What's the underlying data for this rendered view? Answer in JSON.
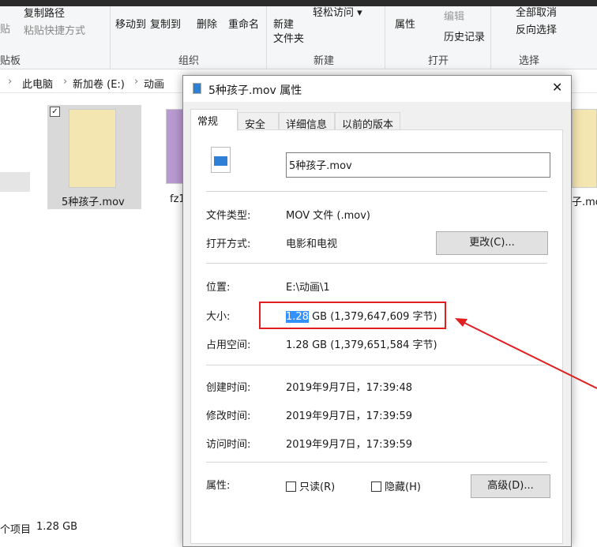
{
  "ribbon": {
    "copy_path": "复制路径",
    "paste_shortcut": "粘贴快捷方式",
    "paste_partial": "贴",
    "move_to": "移动到",
    "copy_to": "复制到",
    "delete": "删除",
    "rename": "重命名",
    "new_folder_1": "新建",
    "new_folder_2": "文件夹",
    "easy_access": "轻松访问 ▾",
    "properties": "属性",
    "edit": "编辑",
    "history": "历史记录",
    "select_none": "全部取消",
    "invert_selection": "反向选择",
    "groups": {
      "clipboard": "贴板",
      "organize": "组织",
      "new": "新建",
      "open": "打开",
      "select": "选择"
    }
  },
  "breadcrumb": [
    "此电脑",
    "新加卷 (E:)",
    "动画"
  ],
  "files": [
    {
      "name": "5种孩子.mov"
    },
    {
      "name": "fz1"
    },
    {
      "name": "子.mov"
    }
  ],
  "status": {
    "items": "个项目",
    "size": "1.28 GB"
  },
  "dialog": {
    "title": "5种孩子.mov 属性",
    "close": "✕",
    "tabs": [
      "常规",
      "安全",
      "详细信息",
      "以前的版本"
    ],
    "filename": "5种孩子.mov",
    "rows": {
      "type_label": "文件类型:",
      "type_value": "MOV 文件 (.mov)",
      "open_label": "打开方式:",
      "open_value": "电影和电视",
      "change_btn": "更改(C)...",
      "location_label": "位置:",
      "location_value": "E:\\动画\\1",
      "size_label": "大小:",
      "size_selected": "1.28",
      "size_rest": " GB (1,379,647,609 字节)",
      "disk_label": "占用空间:",
      "disk_value": "1.28 GB (1,379,651,584 字节)",
      "created_label": "创建时间:",
      "created_value": "2019年9月7日，17:39:48",
      "modified_label": "修改时间:",
      "modified_value": "2019年9月7日，17:39:59",
      "accessed_label": "访问时间:",
      "accessed_value": "2019年9月7日，17:39:59",
      "attr_label": "属性:",
      "readonly": "只读(R)",
      "hidden": "隐藏(H)",
      "advanced_btn": "高级(D)..."
    }
  },
  "colors": {
    "highlight": "#3390ff",
    "annotation": "#e02020"
  }
}
